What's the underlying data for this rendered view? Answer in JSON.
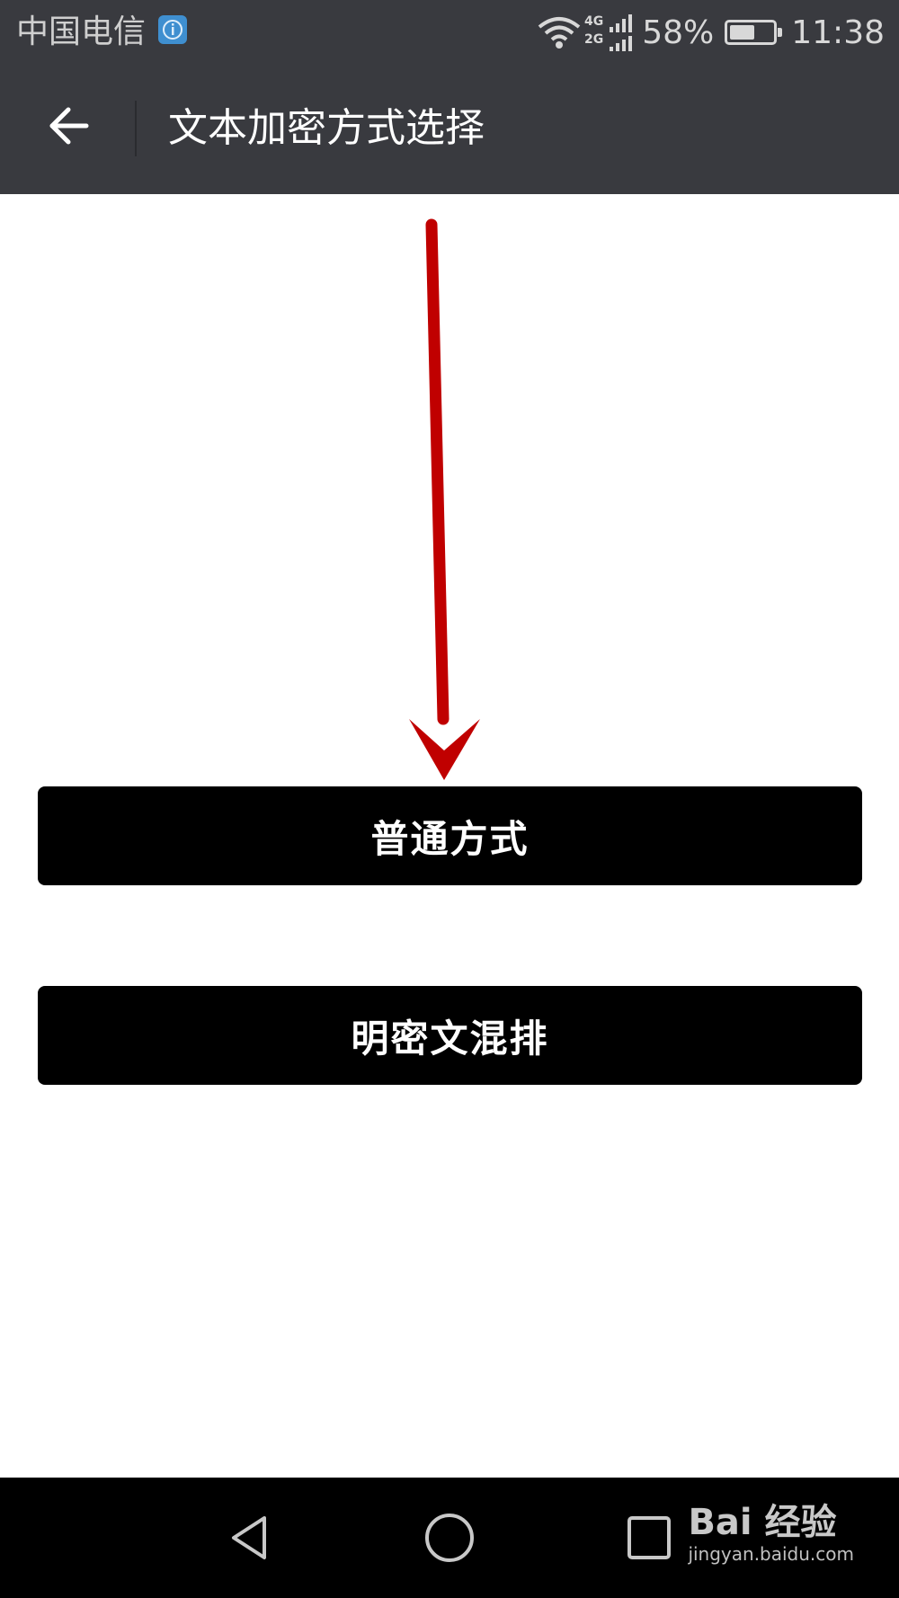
{
  "status_bar": {
    "carrier": "中国电信",
    "network_label_top": "4G",
    "network_label_bottom": "2G",
    "battery_percent": "58%",
    "battery_level": 0.58,
    "time": "11:38"
  },
  "toolbar": {
    "title": "文本加密方式选择"
  },
  "options": [
    {
      "label": "普通方式"
    },
    {
      "label": "明密文混排"
    }
  ],
  "annotation": {
    "arrow_color": "#c00000"
  },
  "watermark": {
    "logo": "Bai 经验",
    "url": "jingyan.baidu.com"
  },
  "colors": {
    "toolbar_bg": "#393a3f",
    "button_bg": "#000000",
    "button_text": "#ffffff"
  }
}
